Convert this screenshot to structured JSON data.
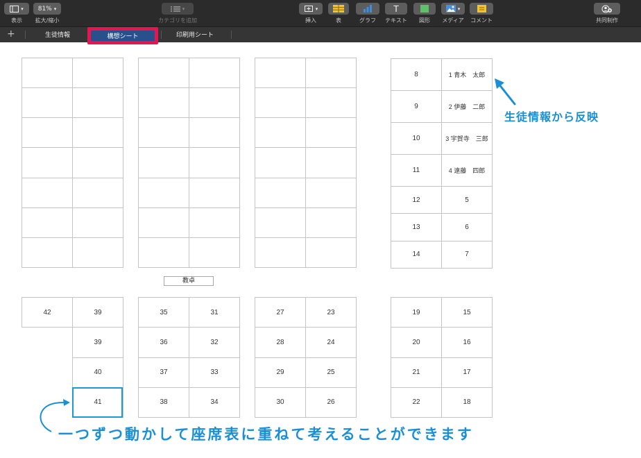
{
  "toolbar": {
    "view_label": "表示",
    "zoom_value": "81%",
    "zoom_label": "拡大/縮小",
    "category_label": "カテゴリを追加",
    "insert_label": "挿入",
    "table_label": "表",
    "chart_label": "グラフ",
    "text_label": "テキスト",
    "shape_label": "図形",
    "media_label": "メディア",
    "comment_label": "コメント",
    "collab_label": "共同制作",
    "text_glyph": "T"
  },
  "sheets": {
    "add": "+",
    "tab1": "生徒情報",
    "tab2": "構想シート",
    "tab3": "印刷用シート"
  },
  "desk_label": "教卓",
  "table_right_top": [
    [
      "8",
      "1 青木　太郎"
    ],
    [
      "9",
      "2 伊藤　二郎"
    ],
    [
      "10",
      "3 宇賀寺　三郎"
    ],
    [
      "11",
      "4 遠藤　四郎"
    ],
    [
      "12",
      "5"
    ],
    [
      "13",
      "6"
    ],
    [
      "14",
      "7"
    ]
  ],
  "table_bottom_1": [
    [
      "42",
      "39"
    ],
    [
      "",
      "39"
    ],
    [
      "",
      "40"
    ],
    [
      "",
      "41"
    ]
  ],
  "table_bottom_2": [
    [
      "35",
      "31"
    ],
    [
      "36",
      "32"
    ],
    [
      "37",
      "33"
    ],
    [
      "38",
      "34"
    ]
  ],
  "table_bottom_3": [
    [
      "27",
      "23"
    ],
    [
      "28",
      "24"
    ],
    [
      "29",
      "25"
    ],
    [
      "30",
      "26"
    ]
  ],
  "table_bottom_4": [
    [
      "19",
      "15"
    ],
    [
      "20",
      "16"
    ],
    [
      "21",
      "17"
    ],
    [
      "22",
      "18"
    ]
  ],
  "annotation_top": "生徒情報から反映",
  "annotation_bottom": "一つずつ動かして座席表に重ねて考えることができます",
  "colors": {
    "annotation": "#1a8fd6",
    "highlight_border": "#e3174f",
    "active_tab": "#28508a",
    "toolbar": "#2b2b2b"
  }
}
